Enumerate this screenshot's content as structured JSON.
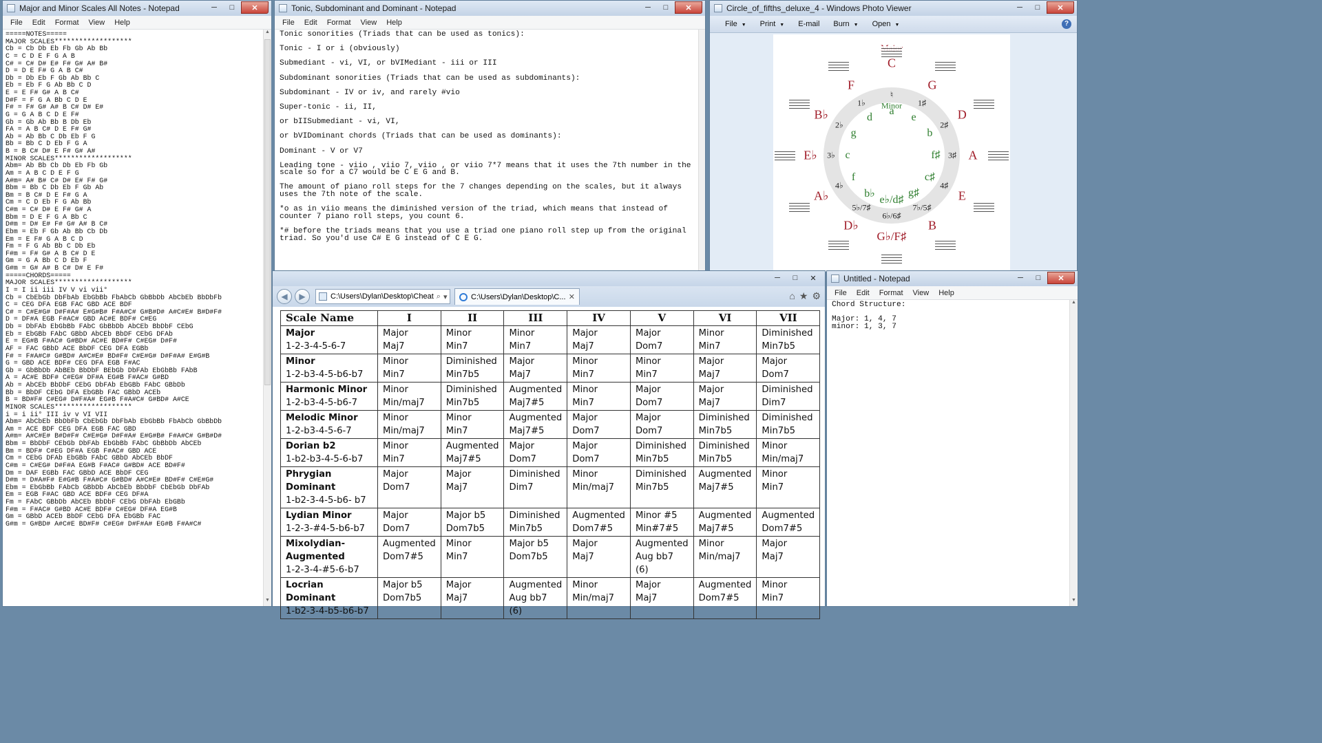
{
  "notepad_left": {
    "title": "Major and Minor Scales All Notes - Notepad",
    "menu": [
      "File",
      "Edit",
      "Format",
      "View",
      "Help"
    ],
    "text": "=====NOTES=====\nMAJOR SCALES*******************\nCb = Cb Db Eb Fb Gb Ab Bb\nC = C D E F G A B\nC# = C# D# E# F# G# A# B#\nD = D E F# G A B C#\nDb = Db Eb F Gb Ab Bb C\nEb = Eb F G Ab Bb C D\nE = E F# G# A B C#\nD#F = F G A Bb C D E\nF# = F# G# A# B C# D# E#\nG = G A B C D E F#\nGb = Gb Ab Bb B Db Eb\nFA = A B C# D E F# G#\nAb = Ab Bb C Db Eb F G\nBb = Bb C D Eb F G A\nB = B C# D# E F# G# A#\nMINOR SCALES*******************\nAbm= Ab Bb Cb Db Eb Fb Gb\nAm = A B C D E F G\nA#m= A# B# C# D# E# F# G#\nBbm = Bb C Db Eb F Gb Ab\nBm = B C# D E F# G A\nCm = C D Eb F G Ab Bb\nC#m = C# D# E F# G# A\nBbm = D E F G A Bb C\nD#m = D# E# F# G# A# B C#\nEbm = Eb F Gb Ab Bb Cb Db\nEm = E F# G A B C D\nFm = F G Ab Bb C Db Eb\nF#m = F# G# A B C# D E\nGm = G A Bb C D Eb F\nG#m = G# A# B C# D# E F#\n=====CHORDS=====\nMAJOR SCALES*******************\nI = I ii iii IV V vi vii°\nCb = CbEbGb DbFbAb EbGbBb FbAbCb GbBbDb AbCbEb BbDbFb\nC = CEG DFA EGB FAC GBD ACE BDF\nC# = C#E#G# D#F#A# E#G#B# F#A#C# G#B#D# A#C#E# B#D#F#\nD = DF#A EGB F#AC# GBD AC#E BDF# C#EG\nDb = DbFAb EbGbBb FAbC GbBbDb AbCEb BbDbF CEbG\nEb = EbGBb FAbC GBbD AbCEb BbDF CEbG DFAb\nE = EG#B F#AC# G#BD# AC#E BD#F# C#EG# D#F#\nAF = FAC GBbD ACE BbDF CEG DFA EGBb\nF# = F#A#C# G#BD# A#C#E# BD#F# C#E#G# D#F#A# E#G#B\nG = GBD ACE BDF# CEG DFA EGB F#AC\nGb = GbBbDb AbBEb BbDbF BEbGb DbFAb EbGbBb FAbB\nA = AC#E BDF# C#EG# DF#A EG#B F#AC# G#BD\nAb = AbCEb BbDbF CEbG DbFAb EbGBb FAbC GBbDb\nBb = BbDF CEbG DFA EbGBb FAC GBbD ACEb\nB = BD#F# C#EG# D#F#A# EG#B F#A#C# G#BD# A#CE\nMINOR SCALES*******************\ni = i ii° III iv v VI VII\nAbm= AbCbEb BbDbFb CbEbGb DbFbAb EbGbBb FbAbCb GbBbDb\nAm = ACE BDF CEG DFA EGB FAC GBD\nA#m= A#C#E# B#D#F# C#E#G# D#F#A# E#G#B# F#A#C# G#B#D#\nBbm = BbDbF CEbGb DbFAb EbGbBb FAbC GbBbDb AbCEb\nBm = BDF# C#EG DF#A EGB F#AC# GBD ACE\nCm = CEbG DFAb EbGBb FAbC GBbD AbCEb BbDF\nC#m = C#EG# D#F#A EG#B F#AC# G#BD# ACE BD#F#\nDm = DAF EGBb FAC GBbD ACE BbDF CEG\nD#m = D#A#F# E#G#B F#A#C# G#BD# A#C#E# BD#F# C#E#G#\nEbm = EbGbBb FAbCb GBbDb AbCbEb BbDbF CbEbGb DbFAb\nEm = EGB F#AC GBD ACE BDF# CEG DF#A\nFm = FAbC GBbDb AbCEb BbDbF CEbG DbFAb EbGBb\nF#m = F#AC# G#BD AC#E BDF# C#EG# DF#A EG#B\nGm = GBbD ACEb BbDF CEbG DFA EbGBb FAC\nG#m = G#BD# A#C#E BD#F# C#EG# D#F#A# EG#B F#A#C#"
  },
  "notepad_mid": {
    "title": "Tonic, Subdominant and Dominant - Notepad",
    "menu": [
      "File",
      "Edit",
      "Format",
      "View",
      "Help"
    ],
    "text": "Tonic sonorities (Triads that can be used as tonics):\n\nTonic - I or i (obviously)\n\nSubmediant - vi, VI, or bVIMediant - iii or III\n\nSubdominant sonorities (Triads that can be used as subdominants):\n\nSubdominant - IV or iv, and rarely #vio\n\nSuper-tonic - ii, II,\n\nor bIISubmediant - vi, VI,\n\nor bVIDominant chords (Triads that can be used as dominants):\n\nDominant - V or V7\n\nLeading tone - viio , viio 7, viio , or viio 7*7 means that it uses the 7th number in the\nscale so for a C7 would be C E G and B.\n\nThe amount of piano roll steps for the 7 changes depending on the scales, but it always\nuses the 7th note of the scale.\n\n*o as in viio means the diminished version of the triad, which means that instead of\ncounter 7 piano roll steps, you count 6.\n\n*# before the triads means that you use a triad one piano roll step up from the original\ntriad. So you'd use C# E G instead of C E G."
  },
  "photo_viewer": {
    "title": "Circle_of_fifths_deluxe_4 - Windows Photo Viewer",
    "menu": [
      {
        "label": "File",
        "dropdown": true
      },
      {
        "label": "Print",
        "dropdown": true
      },
      {
        "label": "E-mail",
        "dropdown": false
      },
      {
        "label": "Burn",
        "dropdown": true
      },
      {
        "label": "Open",
        "dropdown": true
      }
    ],
    "help": "?",
    "circle": {
      "major_label": "Major",
      "minor_label": "Minor",
      "major_keys": [
        "C",
        "G",
        "D",
        "A",
        "E",
        "B",
        "G♭/F♯",
        "D♭",
        "A♭",
        "E♭",
        "B♭",
        "F"
      ],
      "minor_keys": [
        "a",
        "e",
        "b",
        "f♯",
        "c♯",
        "g♯",
        "e♭/d♯",
        "b♭",
        "f",
        "c",
        "g",
        "d"
      ],
      "counts": [
        "♮",
        "1♯",
        "2♯",
        "3♯",
        "4♯",
        "7♭/5♯",
        "6♭/6♯",
        "5♭/7♯",
        "4♭",
        "3♭",
        "2♭",
        "1♭"
      ]
    }
  },
  "browser": {
    "address": "C:\\Users\\Dylan\\Desktop\\Cheat",
    "tab_title": "C:\\Users\\Dylan\\Desktop\\C...",
    "table": {
      "headers": [
        "Scale  Name",
        "I",
        "II",
        "III",
        "IV",
        "V",
        "VI",
        "VII"
      ],
      "rows": [
        {
          "name": "Major",
          "formula": "1-2-3-4-5-6-7",
          "cells": [
            [
              "Major",
              "Maj7"
            ],
            [
              "Minor",
              "Min7"
            ],
            [
              "Minor",
              "Min7"
            ],
            [
              "Major",
              "Maj7"
            ],
            [
              "Major",
              "Dom7"
            ],
            [
              "Minor",
              "Min7"
            ],
            [
              "Diminished",
              "Min7b5"
            ]
          ]
        },
        {
          "name": "Minor",
          "formula": "1-2-b3-4-5-b6-b7",
          "cells": [
            [
              "Minor",
              "Min7"
            ],
            [
              "Diminished",
              "Min7b5"
            ],
            [
              "Major",
              "Maj7"
            ],
            [
              "Minor",
              "Min7"
            ],
            [
              "Minor",
              "Min7"
            ],
            [
              "Major",
              "Maj7"
            ],
            [
              "Major",
              "Dom7"
            ]
          ]
        },
        {
          "name": "Harmonic Minor",
          "formula": "1-2-b3-4-5-b6-7",
          "cells": [
            [
              "Minor",
              "Min/maj7"
            ],
            [
              "Diminished",
              "Min7b5"
            ],
            [
              "Augmented",
              "Maj7#5"
            ],
            [
              "Minor",
              "Min7"
            ],
            [
              "Major",
              "Dom7"
            ],
            [
              "Major",
              "Maj7"
            ],
            [
              "Diminished",
              "Dim7"
            ]
          ]
        },
        {
          "name": "Melodic Minor",
          "formula": "1-2-b3-4-5-6-7",
          "cells": [
            [
              "Minor",
              "Min/maj7"
            ],
            [
              "Minor",
              "Min7"
            ],
            [
              "Augmented",
              "Maj7#5"
            ],
            [
              "Major",
              "Dom7"
            ],
            [
              "Major",
              "Dom7"
            ],
            [
              "Diminished",
              "Min7b5"
            ],
            [
              "Diminished",
              "Min7b5"
            ]
          ]
        },
        {
          "name": "Dorian b2",
          "formula": "1-b2-b3-4-5-6-b7",
          "cells": [
            [
              "Minor",
              "Min7"
            ],
            [
              "Augmented",
              "Maj7#5"
            ],
            [
              "Major",
              "Dom7"
            ],
            [
              "Major",
              "Dom7"
            ],
            [
              "Diminished",
              "Min7b5"
            ],
            [
              "Diminished",
              "Min7b5"
            ],
            [
              "Minor",
              "Min/maj7"
            ]
          ]
        },
        {
          "name": "Phrygian Dominant",
          "formula": "1-b2-3-4-5-b6- b7",
          "cells": [
            [
              "Major",
              "Dom7"
            ],
            [
              "Major",
              "Maj7"
            ],
            [
              "Diminished",
              "Dim7"
            ],
            [
              "Minor",
              "Min/maj7"
            ],
            [
              "Diminished",
              "Min7b5"
            ],
            [
              "Augmented",
              "Maj7#5"
            ],
            [
              "Minor",
              "Min7"
            ]
          ]
        },
        {
          "name": "Lydian Minor",
          "formula": "1-2-3-#4-5-b6-b7",
          "cells": [
            [
              "Major",
              "Dom7"
            ],
            [
              "Major b5",
              "Dom7b5"
            ],
            [
              "Diminished",
              "Min7b5"
            ],
            [
              "Augmented",
              "Dom7#5"
            ],
            [
              "Minor #5",
              "Min#7#5"
            ],
            [
              "Augmented",
              "Maj7#5"
            ],
            [
              "Augmented",
              "Dom7#5"
            ]
          ]
        },
        {
          "name": "Mixolydian-Augmented",
          "formula": "1-2-3-4-#5-6-b7",
          "cells": [
            [
              "Augmented",
              "Dom7#5"
            ],
            [
              "Minor",
              "Min7"
            ],
            [
              "Major b5",
              "Dom7b5"
            ],
            [
              "Major",
              "Maj7"
            ],
            [
              "Augmented",
              "Aug bb7 (6)"
            ],
            [
              "Minor",
              "Min/maj7"
            ],
            [
              "Major",
              "Maj7"
            ]
          ]
        },
        {
          "name": "Locrian Dominant",
          "formula": "1-b2-3-4-b5-b6-b7",
          "cells": [
            [
              "Major b5",
              "Dom7b5"
            ],
            [
              "Major",
              "Maj7"
            ],
            [
              "Augmented",
              "Aug bb7 (6)"
            ],
            [
              "Minor",
              "Min/maj7"
            ],
            [
              "Major",
              "Maj7"
            ],
            [
              "Augmented",
              "Dom7#5"
            ],
            [
              "Minor",
              "Min7"
            ]
          ]
        }
      ]
    }
  },
  "notepad_right": {
    "title": "Untitled - Notepad",
    "menu": [
      "File",
      "Edit",
      "Format",
      "View",
      "Help"
    ],
    "text": "Chord Structure:\n\nMajor: 1, 4, 7\nminor: 1, 3, 7"
  },
  "colors": {
    "major_key": "#a01c28",
    "minor_key": "#2e7e2e",
    "titlebar": "#c3d3e6"
  }
}
